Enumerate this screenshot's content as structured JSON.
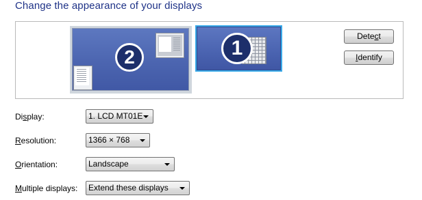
{
  "title": "Change the appearance of your displays",
  "monitors": [
    {
      "number": "2",
      "selected": false
    },
    {
      "number": "1",
      "selected": true
    }
  ],
  "buttons": {
    "detect": {
      "pre": "Dete",
      "accel": "c",
      "post": "t"
    },
    "identify": {
      "pre": "",
      "accel": "I",
      "post": "dentify"
    }
  },
  "settings": {
    "display": {
      "label_pre": "Di",
      "label_accel": "s",
      "label_post": "play:",
      "value": "1. LCD MT01E"
    },
    "resolution": {
      "label_pre": "",
      "label_accel": "R",
      "label_post": "esolution:",
      "value": "1366 × 768"
    },
    "orientation": {
      "label_pre": "",
      "label_accel": "O",
      "label_post": "rientation:",
      "value": "Landscape"
    },
    "multiple_displays": {
      "label_pre": "",
      "label_accel": "M",
      "label_post": "ultiple displays:",
      "value": "Extend these displays"
    }
  },
  "icons": {
    "window_thumb": "window-thumbnail-icon",
    "grid_thumb": "grid-window-icon",
    "dropdown": "chevron-down-icon"
  },
  "colors": {
    "title": "#1e3287",
    "monitor_fill": "#4c65b0",
    "selected_border": "#39a9e8",
    "number_badge": "#1d2f6b"
  }
}
